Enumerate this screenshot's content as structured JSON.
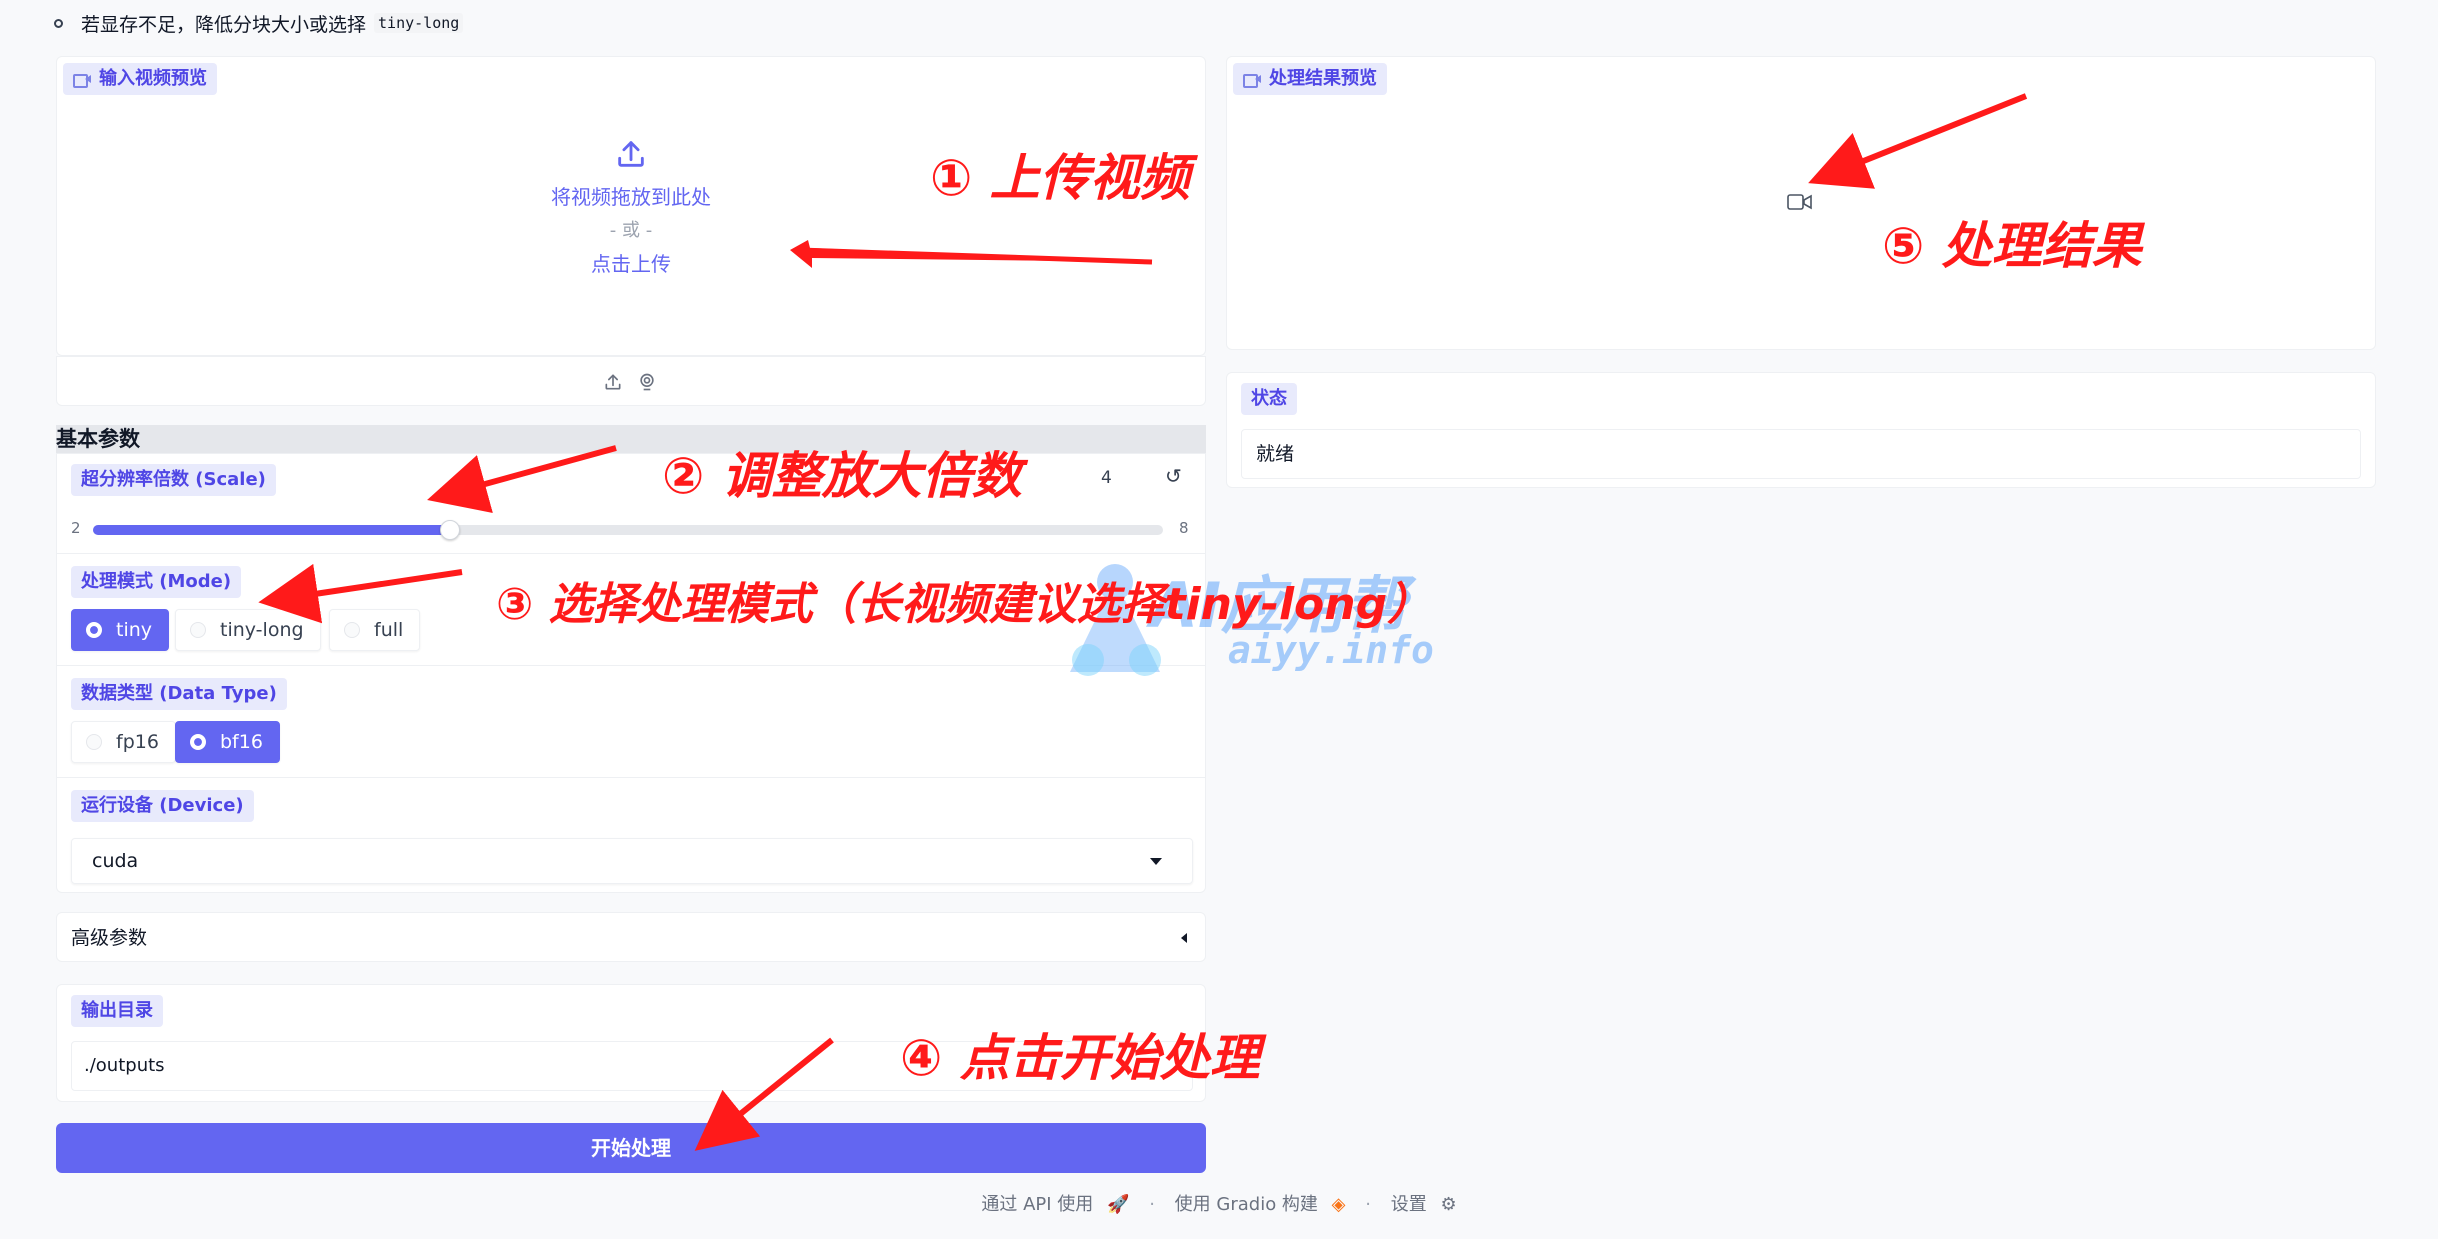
{
  "note": {
    "text": "若显存不足，降低分块大小或选择",
    "code": "tiny-long"
  },
  "input_video": {
    "label": "输入视频预览",
    "drop_text": "将视频拖放到此处",
    "or_text": "- 或 -",
    "click_text": "点击上传"
  },
  "result_video": {
    "label": "处理结果预览"
  },
  "status": {
    "label": "状态",
    "value": "就绪"
  },
  "basic_params": {
    "title": "基本参数",
    "scale": {
      "label": "超分辨率倍数 (Scale)",
      "value": 4,
      "min": "2",
      "max": "8",
      "value_text": "4"
    },
    "mode": {
      "label": "处理模式 (Mode)",
      "options": [
        "tiny",
        "tiny-long",
        "full"
      ],
      "selected": "tiny"
    },
    "dtype": {
      "label": "数据类型 (Data Type)",
      "options": [
        "fp16",
        "bf16"
      ],
      "selected": "bf16"
    },
    "device": {
      "label": "运行设备 (Device)",
      "value": "cuda"
    }
  },
  "advanced": {
    "label": "高级参数"
  },
  "output_dir": {
    "label": "输出目录",
    "value": "./outputs"
  },
  "start_button": {
    "label": "开始处理"
  },
  "footer": {
    "api": "通过 API 使用",
    "gradio": "使用 Gradio 构建",
    "settings": "设置"
  },
  "annotations": {
    "a1": "① 上传视频",
    "a2": "② 调整放大倍数",
    "a3": "③ 选择处理模式（长视频建议选择tiny-long）",
    "a4": "④ 点击开始处理",
    "a5": "⑤ 处理结果"
  },
  "watermark": {
    "name": "AI应用帮",
    "site": "aiyy.info"
  },
  "colors": {
    "accent": "#6366f1",
    "annotation": "#ff1a1a",
    "chip_bg": "#e8eafc"
  }
}
